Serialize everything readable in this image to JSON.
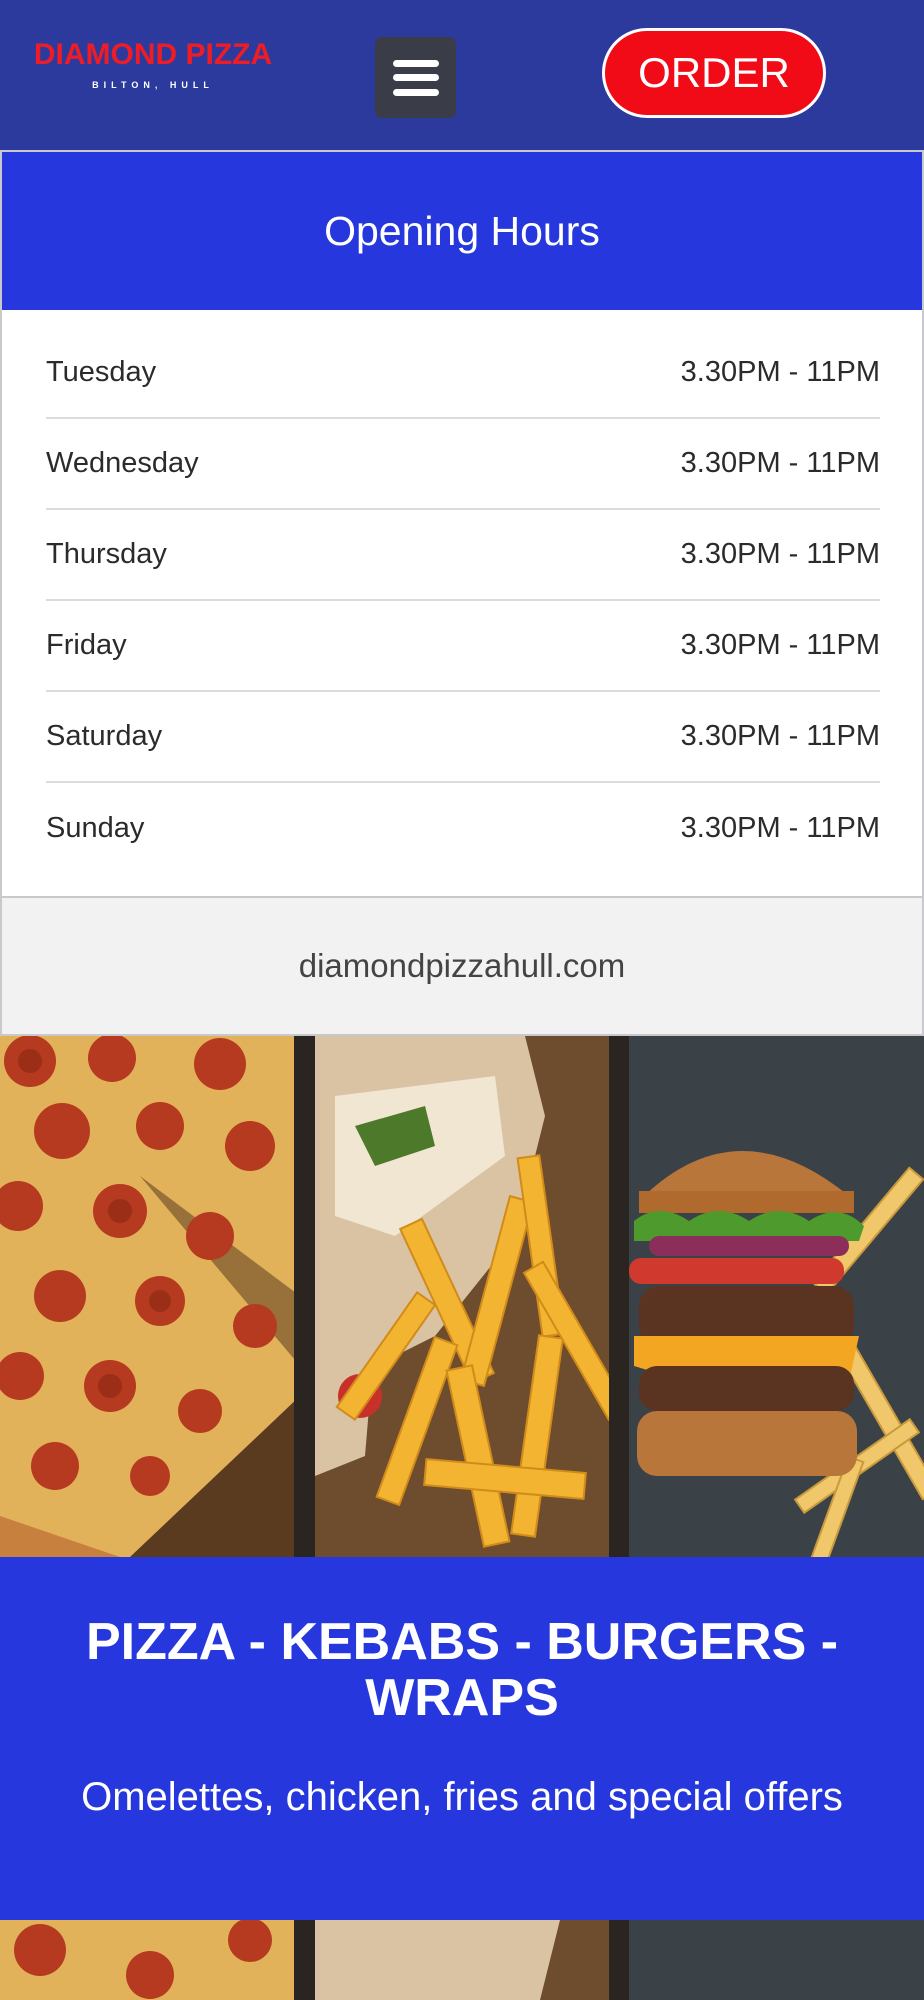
{
  "header": {
    "logo_title": "DIAMOND PIZZA",
    "logo_subtitle": "BILTON, HULL",
    "menu_icon": "hamburger-menu-icon",
    "order_label": "ORDER"
  },
  "hours": {
    "title": "Opening Hours",
    "rows": [
      {
        "day": "Tuesday",
        "time": "3.30PM - 11PM"
      },
      {
        "day": "Wednesday",
        "time": "3.30PM - 11PM"
      },
      {
        "day": "Thursday",
        "time": "3.30PM - 11PM"
      },
      {
        "day": "Friday",
        "time": "3.30PM - 11PM"
      },
      {
        "day": "Saturday",
        "time": "3.30PM - 11PM"
      },
      {
        "day": "Sunday",
        "time": "3.30PM - 11PM"
      }
    ],
    "footer": "diamondpizzahull.com"
  },
  "promo": {
    "title": "PIZZA - KEBABS - BURGERS - WRAPS",
    "subtitle": "Omelettes, chicken, fries and special offers"
  },
  "colors": {
    "header_bg": "#2d3a9d",
    "accent_blue": "#2637dd",
    "order_red": "#f10b16",
    "logo_red": "#ee1c25"
  }
}
